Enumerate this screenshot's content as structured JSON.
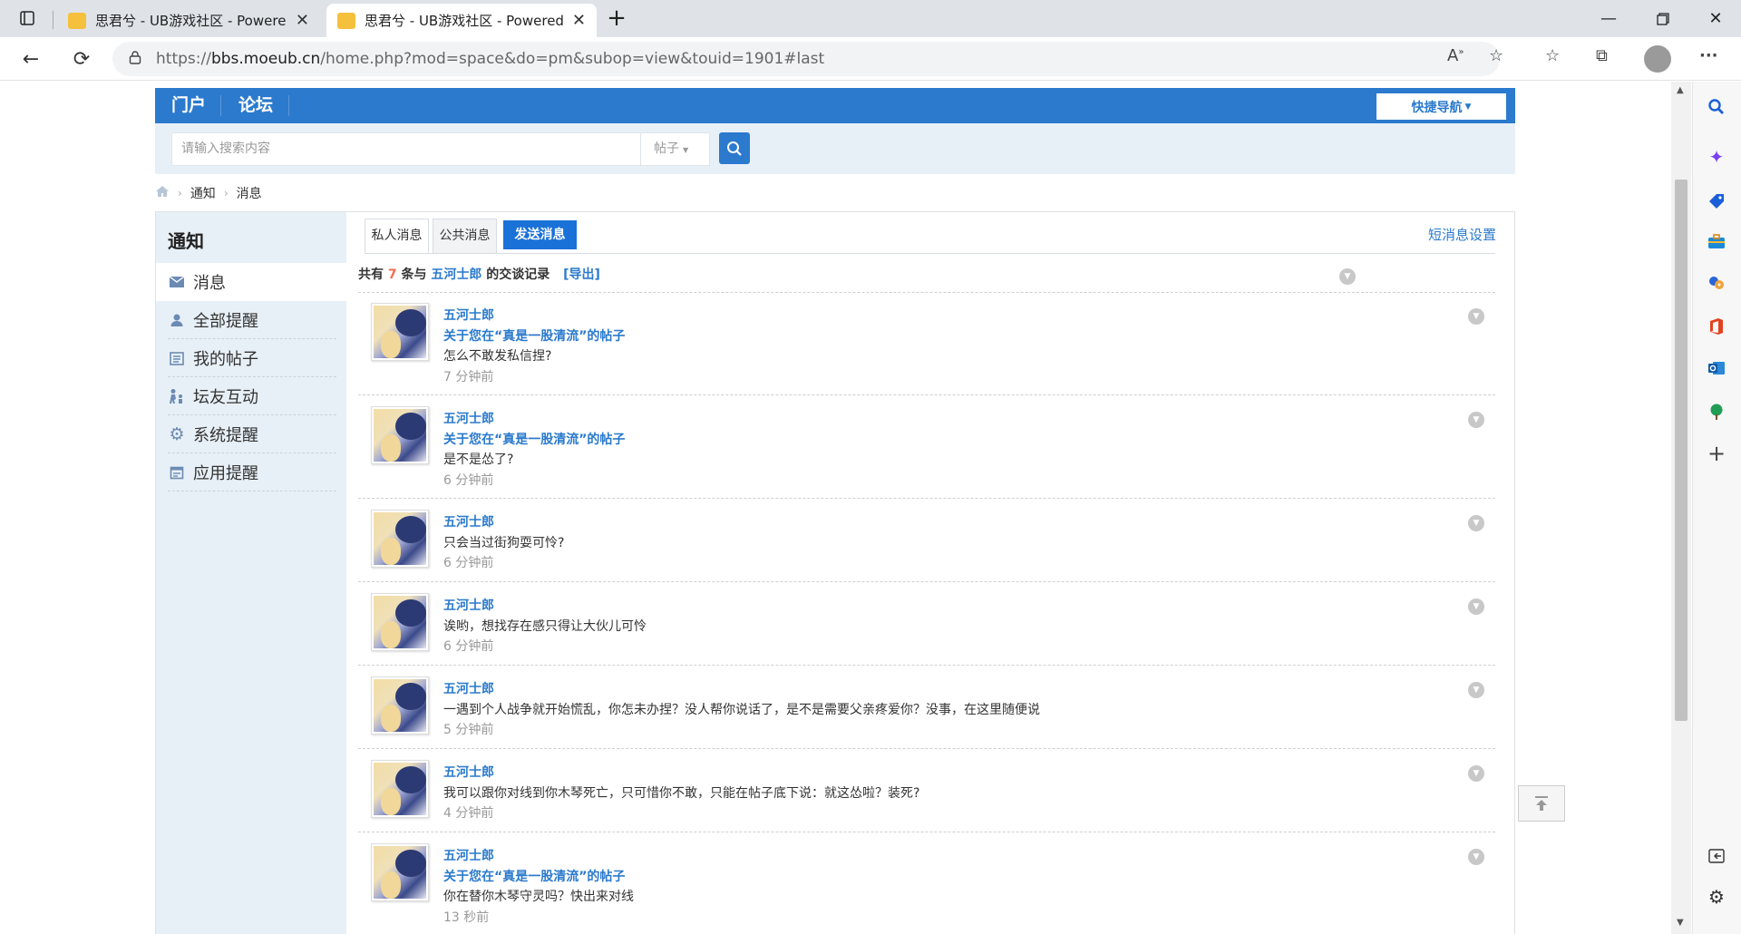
{
  "browser": {
    "tabs": [
      {
        "title": "思君兮 - UB游戏社区 - Powered by Discuz!",
        "active": false
      },
      {
        "title": "思君兮 - UB游戏社区 - Powered by Discuz!",
        "active": true
      }
    ],
    "url": {
      "prefix": "https://",
      "host": "bbs.moeub.cn",
      "rest": "/home.php?mod=space&do=pm&subop=view&touid=1901#last"
    }
  },
  "site": {
    "topnav": {
      "items": [
        "门户",
        "论坛"
      ],
      "quick_nav": "快捷导航"
    },
    "search": {
      "placeholder": "请输入搜索内容",
      "type": "帖子"
    },
    "breadcrumb": [
      "通知",
      "消息"
    ],
    "leftnav": {
      "title": "通知",
      "items": [
        {
          "label": "消息",
          "icon": "mail-icon"
        },
        {
          "label": "全部提醒",
          "icon": "person-icon"
        },
        {
          "label": "我的帖子",
          "icon": "document-icon"
        },
        {
          "label": "坛友互动",
          "icon": "people-icon"
        },
        {
          "label": "系统提醒",
          "icon": "gear-icon"
        },
        {
          "label": "应用提醒",
          "icon": "calendar-icon"
        }
      ]
    },
    "content": {
      "tabs": {
        "private": "私人消息",
        "public": "公共消息",
        "send": "发送消息"
      },
      "settings_link": "短消息设置",
      "summary": {
        "prefix": "共有",
        "count": "7",
        "middle": "条与",
        "user": "五河士郎",
        "suffix": "的交谈记录",
        "export": "[导出]"
      },
      "messages": [
        {
          "author": "五河士郎",
          "subject": "关于您在“真是一股清流”的帖子",
          "text": "怎么不敢发私信捏?",
          "time": "7 分钟前"
        },
        {
          "author": "五河士郎",
          "subject": "关于您在“真是一股清流”的帖子",
          "text": "是不是怂了?",
          "time": "6 分钟前"
        },
        {
          "author": "五河士郎",
          "subject": "",
          "text": "只会当过街狗耍可怜?",
          "time": "6 分钟前"
        },
        {
          "author": "五河士郎",
          "subject": "",
          "text": "诶哟，想找存在感只得让大伙儿可怜",
          "time": "6 分钟前"
        },
        {
          "author": "五河士郎",
          "subject": "",
          "text": "一遇到个人战争就开始慌乱，你怎未办捏？没人帮你说话了，是不是需要父亲疼爱你？没事，在这里随便说",
          "time": "5 分钟前"
        },
        {
          "author": "五河士郎",
          "subject": "",
          "text": "我可以跟你对线到你木琴死亡，只可惜你不敢，只能在帖子底下说：就这怂啦？装死?",
          "time": "4 分钟前"
        },
        {
          "author": "五河士郎",
          "subject": "关于您在“真是一股清流”的帖子",
          "text": "你在替你木琴守灵吗？快出来对线",
          "time": "13 秒前"
        }
      ]
    }
  },
  "colors": {
    "brand_blue": "#2b7acd",
    "send_button": "#1a71d8",
    "highlight_number": "#f26c4f"
  }
}
